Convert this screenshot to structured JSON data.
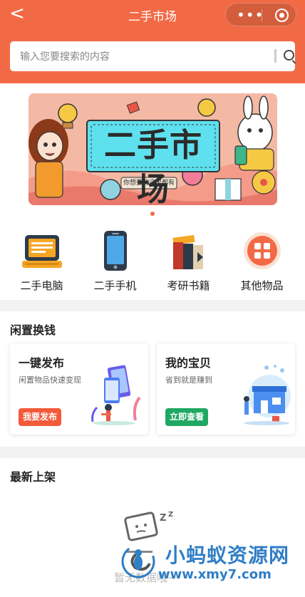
{
  "nav": {
    "back_glyph": "<",
    "title": "二手市场",
    "more_glyph": "•••"
  },
  "search": {
    "placeholder": "输入您要搜索的内容"
  },
  "banner": {
    "title": "二手市场",
    "tagline": "你想要的这里都有"
  },
  "carousel": {
    "count": 1,
    "active": 0
  },
  "categories": [
    {
      "label": "二手电脑",
      "icon": "computer-icon"
    },
    {
      "label": "二手手机",
      "icon": "phone-icon"
    },
    {
      "label": "考研书籍",
      "icon": "books-icon"
    },
    {
      "label": "其他物品",
      "icon": "grid-icon"
    }
  ],
  "idle": {
    "title": "闲置换钱",
    "cards": [
      {
        "title": "一键发布",
        "subtitle": "闲置物品快速变现",
        "button": "我要发布",
        "button_color": "#f25a3a"
      },
      {
        "title": "我的宝贝",
        "subtitle": "省到就是赚到",
        "button": "立即查看",
        "button_color": "#1ea862"
      }
    ]
  },
  "latest": {
    "title": "最新上架",
    "empty_text": "暂无数据哦~"
  },
  "watermark": {
    "name": "小蚂蚁资源网",
    "url": "www.xmy7.com"
  },
  "colors": {
    "primary": "#f26a45",
    "green": "#1ea862"
  }
}
